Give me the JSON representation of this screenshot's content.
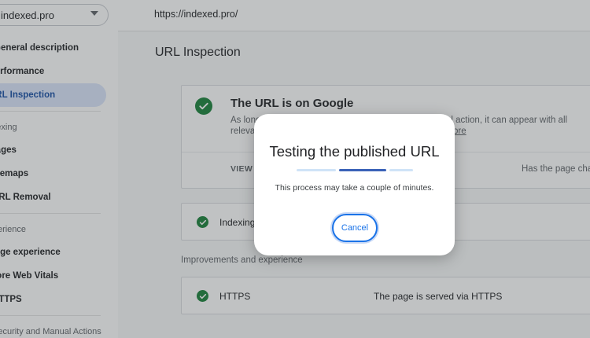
{
  "sidebar": {
    "property": "indexed.pro",
    "items": [
      {
        "label": "General description"
      },
      {
        "label": "Performance"
      },
      {
        "label": "URL Inspection",
        "active": true
      }
    ],
    "index_section": "Indexing",
    "index_items": [
      {
        "label": "Pages"
      },
      {
        "label": "Sitemaps"
      },
      {
        "label": "URL Removal"
      }
    ],
    "experience_section": "Experience",
    "experience_items": [
      {
        "label": "Page experience"
      },
      {
        "label": "Core Web Vitals"
      },
      {
        "label": "HTTPS"
      }
    ],
    "security_section": "Security and Manual Actions"
  },
  "main": {
    "url": "https://indexed.pro/",
    "page_title": "URL Inspection",
    "status_card": {
      "title": "The URL is on Google",
      "desc_line1_start": "As long",
      "desc_line1_end": "al action, it can appear with all",
      "desc_line2_start": "relevan",
      "link": "ore",
      "view_button": "VIEW C",
      "has_page": "Has the page cha"
    },
    "indexing_card": {
      "label": "Indexing p"
    },
    "improvements_label": "Improvements and experience",
    "https_card": {
      "label": "HTTPS",
      "value": "The page is served via HTTPS"
    }
  },
  "dialog": {
    "title": "Testing the published URL",
    "message": "This process may take a couple of minutes.",
    "cancel_label": "Cancel"
  },
  "colors": {
    "accent": "#1a73e8",
    "success": "#188038",
    "active_nav_bg": "#dbe5fb",
    "progress_light": "#cfe3f7",
    "progress_dark": "#3a62b8"
  }
}
